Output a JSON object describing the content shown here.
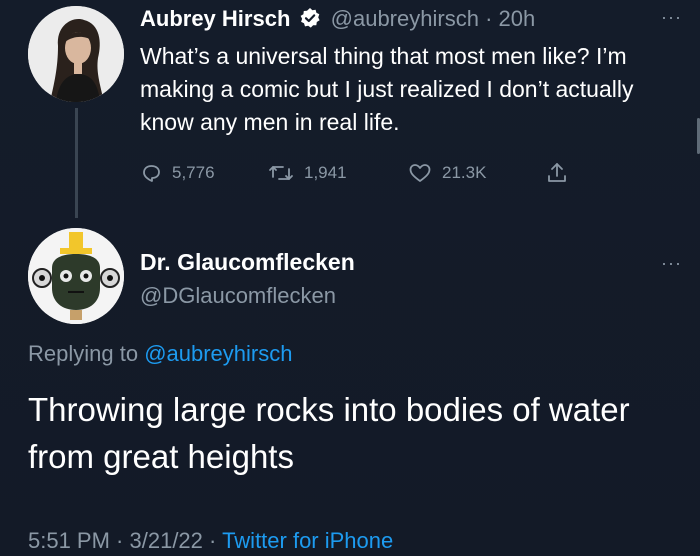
{
  "tweet1": {
    "name": "Aubrey Hirsch",
    "handle": "@aubreyhirsch",
    "separator": "·",
    "time": "20h",
    "more_label": "···",
    "text": "What’s a universal thing that most men like? I’m making a comic but I just realized I don’t actually know any men in real life.",
    "replies": "5,776",
    "retweets": "1,941",
    "likes": "21.3K"
  },
  "tweet2": {
    "name": "Dr. Glaucomflecken",
    "handle": "@DGlaucomflecken",
    "more_label": "···",
    "replying_prefix": "Replying to ",
    "replying_to": "@aubreyhirsch",
    "text": "Throwing large rocks into bodies of water from great heights",
    "time": "5:51 PM",
    "dot1": " · ",
    "date": "3/21/22",
    "dot2": " · ",
    "source": "Twitter for iPhone"
  },
  "colors": {
    "background": "#141c2a",
    "text": "#ffffff",
    "muted": "#8b98a5",
    "link": "#1d9bf0"
  },
  "icons": {
    "reply": "reply-icon",
    "retweet": "retweet-icon",
    "like": "heart-icon",
    "share": "share-icon",
    "verified": "verified-badge-icon",
    "more": "more-options-icon"
  }
}
